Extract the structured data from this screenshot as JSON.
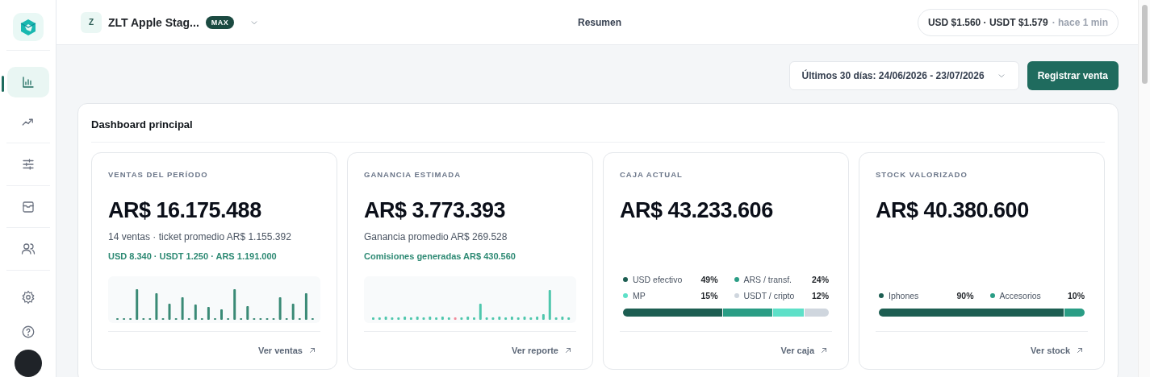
{
  "sidebar": {
    "nav": [
      {
        "selected": true
      },
      {
        "selected": false
      },
      {
        "selected": false
      },
      {
        "selected": false
      },
      {
        "selected": false
      }
    ]
  },
  "header": {
    "workspace_initial": "Z",
    "workspace_name": "ZLT Apple Stag...",
    "plan_badge": "MAX",
    "title": "Resumen",
    "rates": "USD $1.560 · USDT $1.579",
    "rates_updated": "· hace 1 min"
  },
  "toolbar": {
    "date_range": "Últimos 30 días: 24/06/2026 - 23/07/2026",
    "primary_button": "Registrar venta"
  },
  "dashboard": {
    "title": "Dashboard principal",
    "cards": [
      {
        "kind": "sparkline",
        "label": "VENTAS DEL PERÍODO",
        "value": "AR$ 16.175.488",
        "subtitle": "14 ventas · ticket promedio AR$ 1.155.392",
        "highlight": "USD 8.340 · USDT 1.250 · ARS 1.191.000",
        "link": "Ver ventas"
      },
      {
        "kind": "sparkline",
        "label": "GANANCIA ESTIMADA",
        "value": "AR$ 3.773.393",
        "subtitle": "Ganancia promedio AR$ 269.528",
        "highlight": "Comisiones generadas AR$ 430.560",
        "link": "Ver reporte"
      },
      {
        "kind": "breakdown",
        "label": "CAJA ACTUAL",
        "value": "AR$ 43.233.606",
        "segments": [
          {
            "name": "USD efectivo",
            "percent": "49%",
            "color": "#1d5e52"
          },
          {
            "name": "ARS / transf.",
            "percent": "24%",
            "color": "#2a9d85"
          },
          {
            "name": "MP",
            "percent": "15%",
            "color": "#5ee0c8"
          },
          {
            "name": "USDT / cripto",
            "percent": "12%",
            "color": "#cfd6de"
          }
        ],
        "link": "Ver caja"
      },
      {
        "kind": "breakdown",
        "label": "STOCK VALORIZADO",
        "value": "AR$ 40.380.600",
        "segments": [
          {
            "name": "Iphones",
            "percent": "90%",
            "color": "#1d5e52"
          },
          {
            "name": "Accesorios",
            "percent": "10%",
            "color": "#2a9d85"
          }
        ],
        "link": "Ver stock"
      }
    ]
  }
}
